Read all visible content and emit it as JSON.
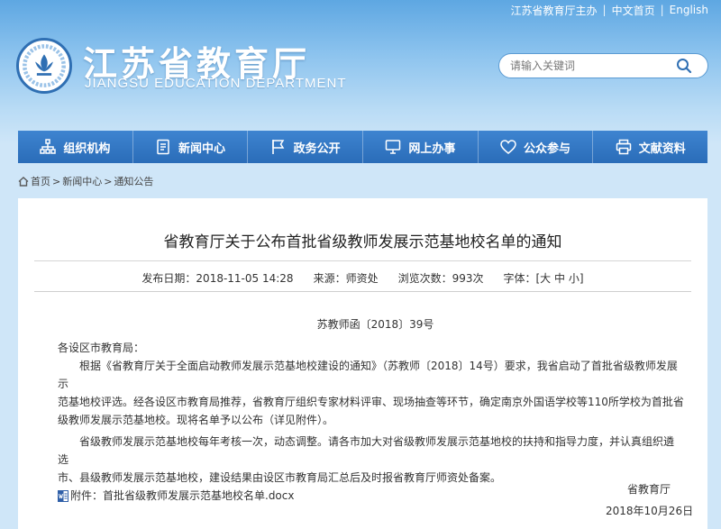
{
  "topbar": {
    "sponsor": "江苏省教育厅主办",
    "lang_cn": "中文首页",
    "lang_en": "English",
    "sep": "|"
  },
  "header": {
    "title": "江苏省教育厅",
    "subtitle": "JIANGSU EDUCATION DEPARTMENT",
    "search_placeholder": "请输入关键词"
  },
  "nav": {
    "items": [
      {
        "label": "组织机构",
        "icon": "org-chart-icon"
      },
      {
        "label": "新闻中心",
        "icon": "news-icon"
      },
      {
        "label": "政务公开",
        "icon": "flag-icon"
      },
      {
        "label": "网上办事",
        "icon": "monitor-icon"
      },
      {
        "label": "公众参与",
        "icon": "heart-icon"
      },
      {
        "label": "文献资料",
        "icon": "printer-icon"
      }
    ]
  },
  "breadcrumb": {
    "home": "首页",
    "sep": ">",
    "news": "新闻中心",
    "notice": "通知公告"
  },
  "article": {
    "title": "省教育厅关于公布首批省级教师发展示范基地校名单的通知",
    "meta": {
      "date": "发布日期：2018-11-05 14:28",
      "source": "来源：师资处",
      "views": "浏览次数：993次",
      "font_label": "字体：[",
      "font_large": "大",
      "font_medium": "中",
      "font_small": "小",
      "font_close": "]"
    },
    "doc_no": "苏教师函〔2018〕39号",
    "salutation": "各设区市教育局：",
    "para1_l1": "根据《省教育厅关于全面启动教师发展示范基地校建设的通知》（苏教师〔2018〕14号）要求，我省启动了首批省级教师发展示",
    "para1_l2": "范基地校评选。经各设区市教育局推荐，省教育厅组织专家材料评审、现场抽查等环节，确定南京外国语学校等110所学校为首批省",
    "para1_l3": "级教师发展示范基地校。现将名单予以公布（详见附件）。",
    "para2_l1": "省级教师发展示范基地校每年考核一次，动态调整。请各市加大对省级教师发展示范基地校的扶持和指导力度，并认真组织遴选",
    "para2_l2": "市、县级教师发展示范基地校，建设结果由设区市教育局汇总后及时报省教育厅师资处备案。",
    "attachment": "附件：首批省级教师发展示范基地校名单.docx",
    "sign_org": "省教育厅",
    "sign_date": "2018年10月26日"
  },
  "colors": {
    "nav_bg": "#2f72bd",
    "header_sky": "#5ea7e2",
    "panel_bg": "#ffffff"
  }
}
